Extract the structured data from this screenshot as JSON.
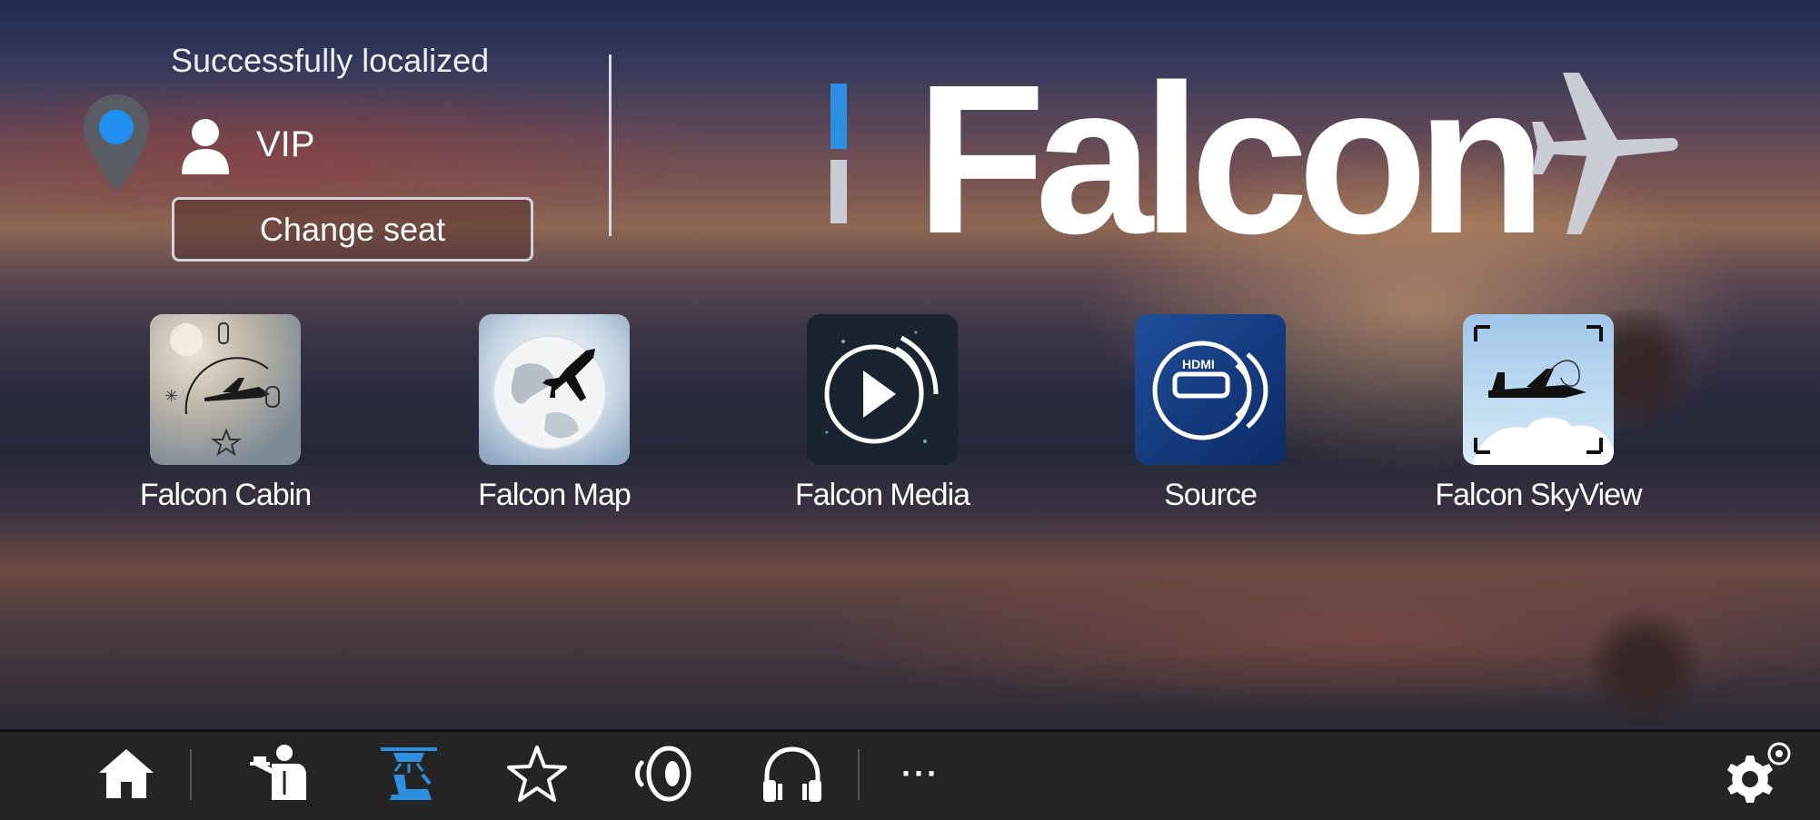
{
  "header": {
    "status_text": "Successfully localized",
    "role": "VIP",
    "change_seat_label": "Change seat"
  },
  "brand": {
    "logo_text": "Falcon",
    "accent_color": "#2c8fe0"
  },
  "apps": [
    {
      "label": "Falcon Cabin",
      "icon": "cabin-control-icon"
    },
    {
      "label": "Falcon Map",
      "icon": "globe-plane-icon"
    },
    {
      "label": "Falcon Media",
      "icon": "play-wireless-icon"
    },
    {
      "label": "Source",
      "icon": "hdmi-wireless-icon"
    },
    {
      "label": "Falcon SkyView",
      "icon": "jet-camera-icon"
    }
  ],
  "bottom_nav": {
    "items": [
      "home-icon",
      "attendant-icon",
      "seat-light-icon",
      "star-icon",
      "speaker-icon",
      "headphones-icon",
      "more-icon",
      "settings-icon"
    ],
    "more_label": "···",
    "active_item": "seat-light-icon",
    "active_color": "#2c8fe0"
  }
}
